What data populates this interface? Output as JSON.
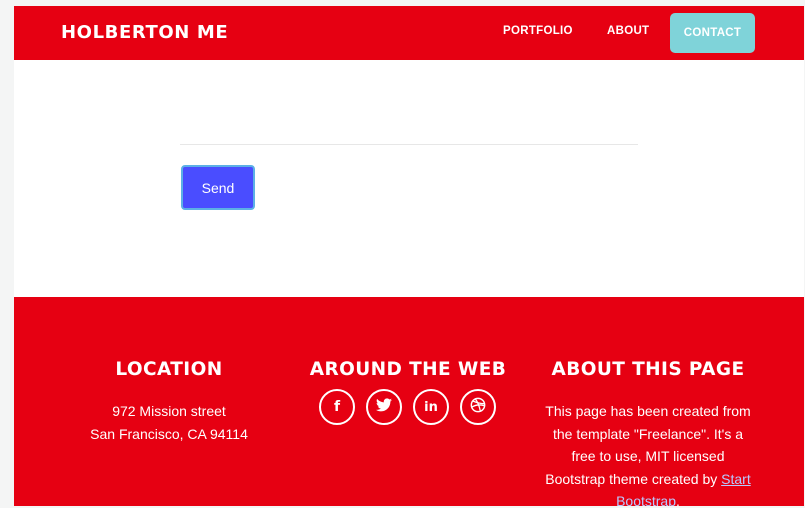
{
  "navbar": {
    "brand": "HOLBERTON ME",
    "links": [
      {
        "label": "PORTFOLIO"
      },
      {
        "label": "ABOUT"
      },
      {
        "label": "CONTACT"
      }
    ]
  },
  "form": {
    "send_label": "Send"
  },
  "footer": {
    "location": {
      "title": "LOCATION",
      "line1": "972 Mission street",
      "line2": "San Francisco, CA 94114"
    },
    "web": {
      "title": "AROUND THE WEB",
      "icons": [
        "facebook-icon",
        "twitter-icon",
        "linkedin-icon",
        "dribbble-icon"
      ]
    },
    "about": {
      "title": "ABOUT THIS PAGE",
      "text": "This page has been created from the template \"Freelance\". It's a free to use, MIT licensed Bootstrap theme created by ",
      "link_text": "Start Bootstrap",
      "trailing": "."
    }
  },
  "colors": {
    "brand_red": "#e60012",
    "contact_active": "#7fd3d9",
    "send_button": "#4a4dff"
  }
}
